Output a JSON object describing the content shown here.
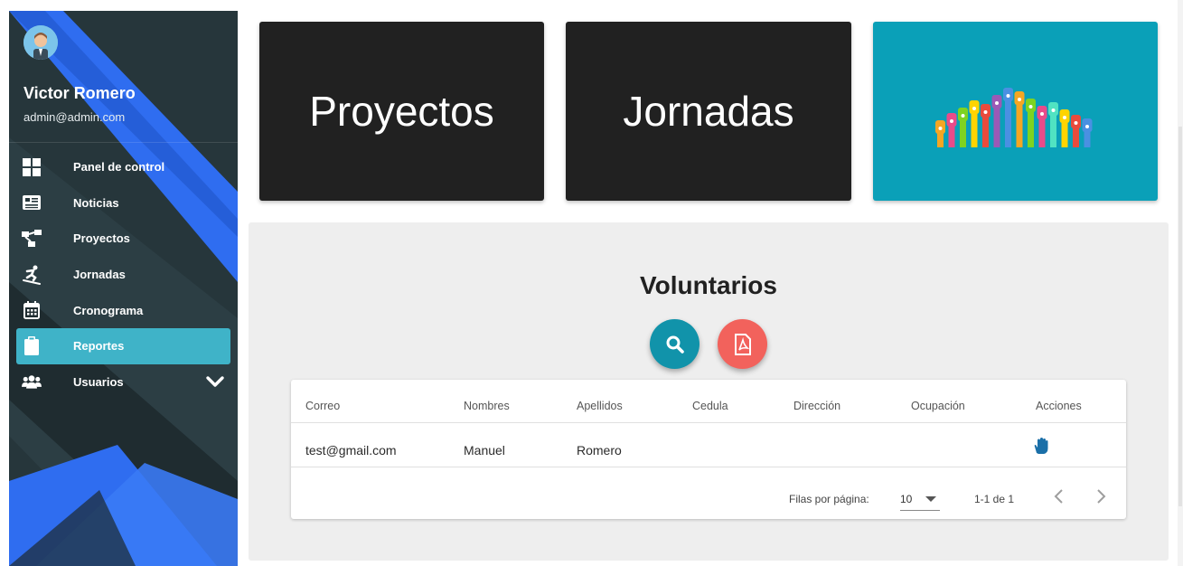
{
  "user": {
    "name": "Victor Romero",
    "email": "admin@admin.com"
  },
  "nav": {
    "items": [
      {
        "label": "Panel de control",
        "icon": "dashboard-icon"
      },
      {
        "label": "Noticias",
        "icon": "newspaper-icon"
      },
      {
        "label": "Proyectos",
        "icon": "project-diagram-icon"
      },
      {
        "label": "Jornadas",
        "icon": "snowboarding-icon"
      },
      {
        "label": "Cronograma",
        "icon": "calendar-icon"
      },
      {
        "label": "Reportes",
        "icon": "clipboard-icon",
        "active": true
      },
      {
        "label": "Usuarios",
        "icon": "users-icon",
        "expandable": true
      }
    ]
  },
  "cards": {
    "proyectos": "Proyectos",
    "jornadas": "Jornadas",
    "image": "raised-hands-image"
  },
  "panel": {
    "title": "Voluntarios",
    "buttons": {
      "search": "search-icon",
      "pdf": "pdf-icon"
    }
  },
  "table": {
    "columns": [
      "Correo",
      "Nombres",
      "Apellidos",
      "Cedula",
      "Dirección",
      "Ocupación",
      "Acciones"
    ],
    "rows": [
      {
        "correo": "test@gmail.com",
        "nombres": "Manuel",
        "apellidos": "Romero",
        "cedula": "",
        "direccion": "",
        "ocupacion": "",
        "accion": "hand-icon"
      }
    ],
    "footer": {
      "rows_per_page_label": "Filas por página:",
      "rows_per_page": "10",
      "range": "1-1 de 1"
    }
  },
  "colors": {
    "sidebar": "#26363b",
    "active": "#3fb3c8",
    "accent_blue": "#2f6df0",
    "teal": "#0aa0b8",
    "search_btn": "#1193aa",
    "pdf_btn": "#f2625c",
    "card_dark": "#212121"
  }
}
